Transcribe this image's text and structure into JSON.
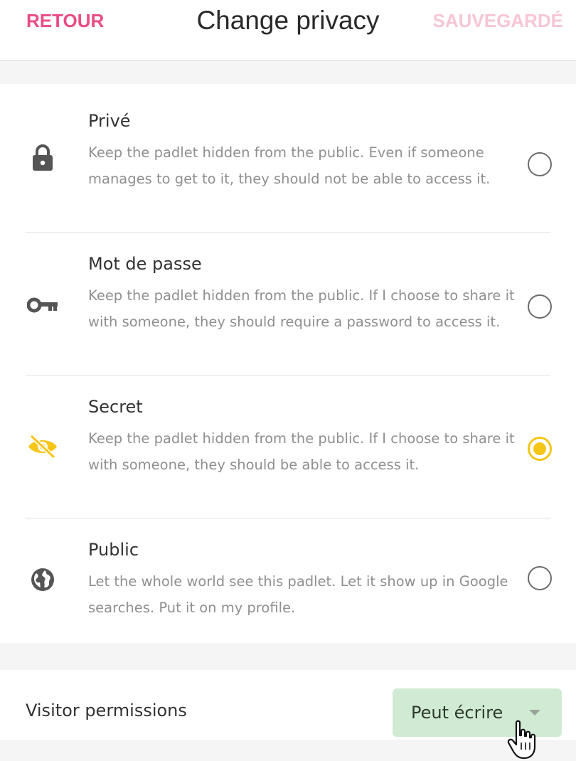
{
  "header": {
    "back_label": "RETOUR",
    "title": "Change privacy",
    "saved_label": "SAUVEGARDÉ"
  },
  "options": [
    {
      "title": "Privé",
      "description": "Keep the padlet hidden from the public. Even if someone manages to get to it, they should not be able to access it.",
      "icon": "lock-icon",
      "selected": false
    },
    {
      "title": "Mot de passe",
      "description": "Keep the padlet hidden from the public. If I choose to share it with someone, they should require a password to access it.",
      "icon": "key-icon",
      "selected": false
    },
    {
      "title": "Secret",
      "description": "Keep the padlet hidden from the public. If I choose to share it with someone, they should be able to access it.",
      "icon": "eye-off-icon",
      "selected": true
    },
    {
      "title": "Public",
      "description": "Let the whole world see this padlet. Let it show up in Google searches. Put it on my profile.",
      "icon": "globe-icon",
      "selected": false
    }
  ],
  "permissions": {
    "label": "Visitor permissions",
    "value": "Peut écrire"
  },
  "colors": {
    "accent_pink": "#e94d86",
    "saved_pink": "#f7c6d6",
    "selected_yellow": "#f5c518",
    "dropdown_green": "#d1ead3"
  }
}
